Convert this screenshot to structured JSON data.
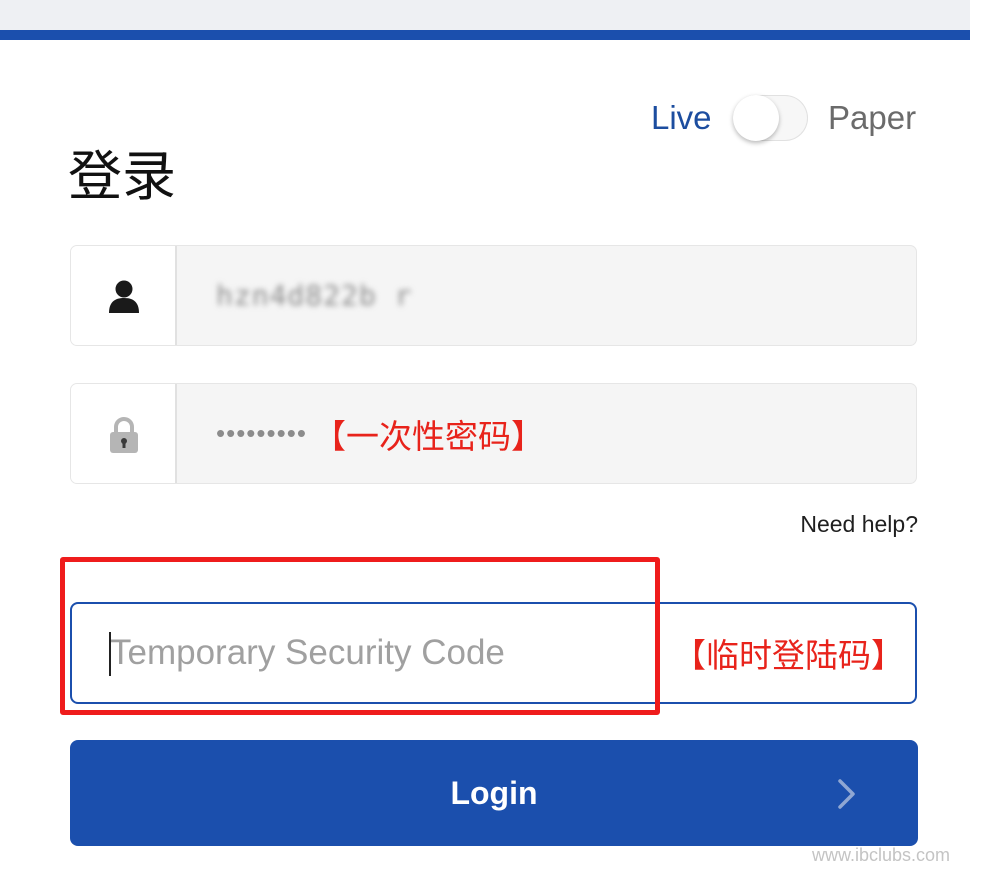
{
  "header": {
    "accent_color": "#1b4fad"
  },
  "mode_toggle": {
    "live_label": "Live",
    "paper_label": "Paper",
    "selected": "Live"
  },
  "title": "登录",
  "username": {
    "icon": "user-icon",
    "value": "hzn4d822b r"
  },
  "password": {
    "icon": "lock-icon",
    "masked_value": "•••••••••",
    "annotation": "【一次性密码】"
  },
  "need_help": "Need help?",
  "security_code": {
    "placeholder": "Temporary Security Code",
    "annotation": "【临时登陆码】"
  },
  "login_button": {
    "label": "Login",
    "icon": "chevron-right-icon"
  },
  "watermark": "www.ibclubs.com",
  "colors": {
    "primary": "#1b4fad",
    "annotation_red": "#e8231b"
  }
}
